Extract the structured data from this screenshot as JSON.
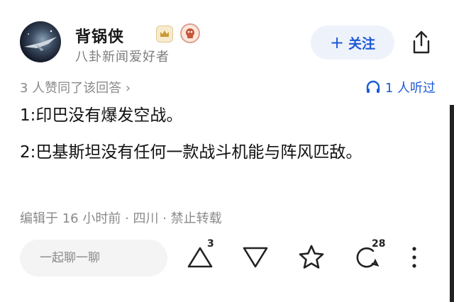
{
  "author": {
    "name": "背锅侠",
    "subtitle": "八卦新闻爱好者"
  },
  "header": {
    "follow_label": "关注"
  },
  "meta": {
    "agree_text": "3 人赞同了该回答 ›",
    "listen_text": "1 人听过"
  },
  "content": {
    "paragraphs": [
      "1:印巴没有爆发空战。",
      "2:巴基斯坦没有任何一款战斗机能与阵风匹敌。"
    ]
  },
  "footer": {
    "edit_info": "编辑于 16 小时前 · 四川 · 禁止转载"
  },
  "actions": {
    "chat_placeholder": "一起聊一聊",
    "upvote_count": "3",
    "comment_count": "28"
  },
  "icons": {
    "share": "share-icon",
    "headphones": "headphones-icon",
    "upvote": "upvote-icon",
    "downvote": "downvote-icon",
    "favorite": "star-icon",
    "comment": "comment-icon",
    "more": "more-icon"
  },
  "colors": {
    "accent": "#1e5ad6",
    "follow_bg": "#eef3fb",
    "muted": "#8a8a8a"
  }
}
